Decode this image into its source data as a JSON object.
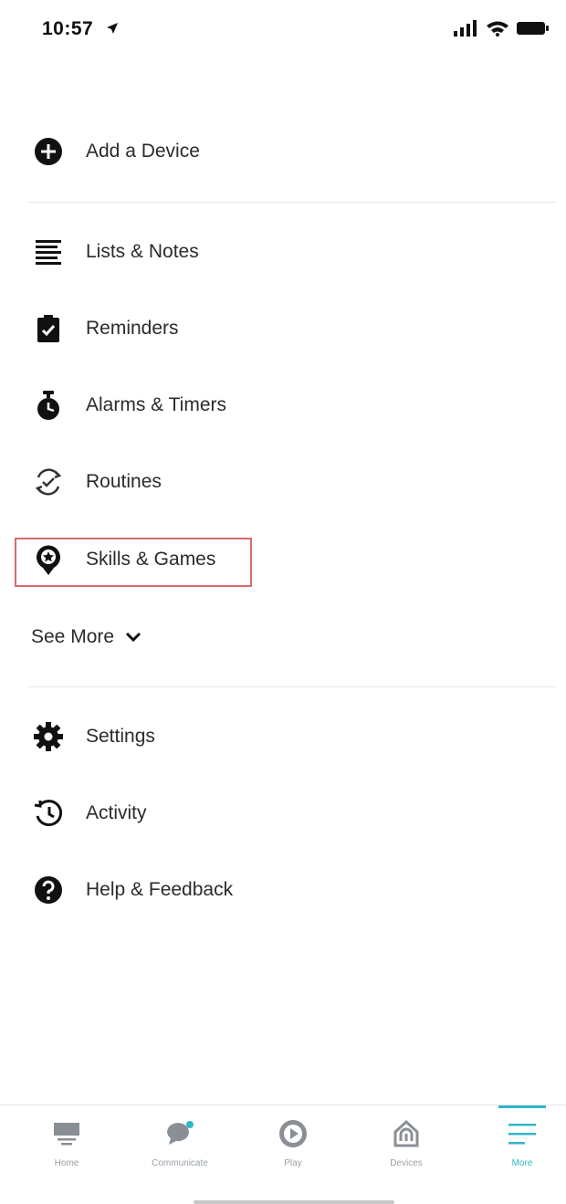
{
  "status_bar": {
    "time": "10:57"
  },
  "menu": {
    "items": [
      {
        "label": "Add a Device",
        "icon": "add-circle-icon"
      },
      {
        "label": "Lists & Notes",
        "icon": "list-icon"
      },
      {
        "label": "Reminders",
        "icon": "clipboard-check-icon"
      },
      {
        "label": "Alarms & Timers",
        "icon": "alarm-icon"
      },
      {
        "label": "Routines",
        "icon": "routines-icon"
      },
      {
        "label": "Skills & Games",
        "icon": "skills-icon"
      },
      {
        "label": "Settings",
        "icon": "gear-icon"
      },
      {
        "label": "Activity",
        "icon": "history-icon"
      },
      {
        "label": "Help & Feedback",
        "icon": "help-icon"
      }
    ],
    "see_more": "See More"
  },
  "bottom_nav": {
    "items": [
      {
        "label": "Home",
        "icon": "home-icon"
      },
      {
        "label": "Communicate",
        "icon": "chat-icon"
      },
      {
        "label": "Play",
        "icon": "play-icon"
      },
      {
        "label": "Devices",
        "icon": "devices-icon"
      },
      {
        "label": "More",
        "icon": "menu-icon",
        "active": true
      }
    ]
  },
  "colors": {
    "accent": "#30b6c8",
    "highlight_border": "#d86a6a"
  }
}
